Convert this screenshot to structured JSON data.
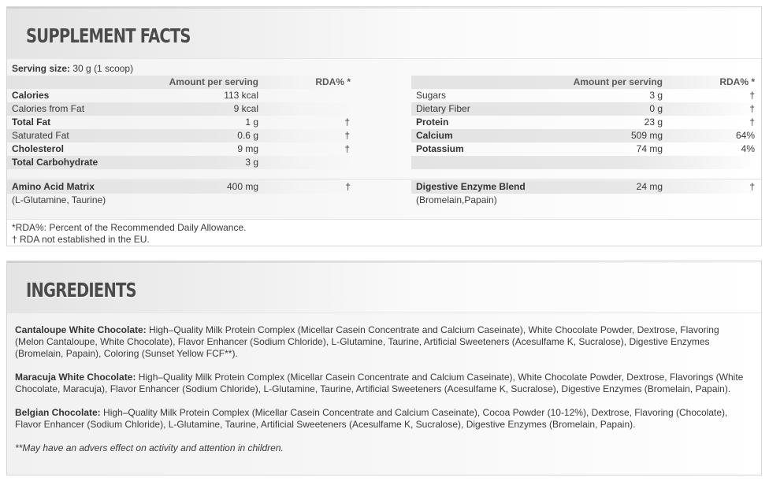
{
  "facts": {
    "title": "SUPPLEMENT FACTS",
    "serving_label": "Serving size:",
    "serving_value": "30 g (1 scoop)",
    "col_amount": "Amount per serving",
    "col_rda": "RDA% *",
    "left_rows": [
      {
        "name": "Calories",
        "amount": "113 kcal",
        "rda": ""
      },
      {
        "name": "Calories from Fat",
        "amount": "9 kcal",
        "rda": ""
      },
      {
        "name": "Total Fat",
        "amount": "1 g",
        "rda": "†"
      },
      {
        "name": "Saturated Fat",
        "amount": "0.6 g",
        "rda": "†"
      },
      {
        "name": "Cholesterol",
        "amount": "9 mg",
        "rda": "†"
      },
      {
        "name": "Total Carbohydrate",
        "amount": "3 g",
        "rda": ""
      }
    ],
    "right_rows": [
      {
        "name": "Sugars",
        "amount": "3 g",
        "rda": "†"
      },
      {
        "name": "Dietary Fiber",
        "amount": "0 g",
        "rda": "†"
      },
      {
        "name": "Protein",
        "amount": "23 g",
        "rda": "†"
      },
      {
        "name": "Calcium",
        "amount": "509 mg",
        "rda": "64%"
      },
      {
        "name": "Potassium",
        "amount": "74 mg",
        "rda": "4%"
      },
      {
        "name": "",
        "amount": "",
        "rda": ""
      }
    ],
    "blend_left": {
      "name": "Amino Acid Matrix",
      "amount": "400 mg",
      "rda": "†",
      "sub": "(L-Glutamine, Taurine)"
    },
    "blend_right": {
      "name": "Digestive Enzyme Blend",
      "amount": "24 mg",
      "rda": "†",
      "sub": "(Bromelain,Papain)"
    },
    "note1": "*RDA%: Percent of the Recommended Daily Allowance.",
    "note2": "† RDA not established in the EU."
  },
  "ingredients": {
    "title": "INGREDIENTS",
    "items": [
      {
        "flavor": "Cantaloupe White Chocolate:",
        "text": " High–Quality Milk Protein Complex (Micellar Casein Concentrate and Calcium Caseinate), White Chocolate Powder, Dextrose, Flavoring (Melon Cantaloupe, White Chocolate), Flavor Enhancer (Sodium Chloride), L-Glutamine, Taurine, Artificial Sweeteners (Acesulfame K, Sucralose), Digestive Enzymes (Bromelain, Papain), Coloring (Sunset Yellow FCF**)."
      },
      {
        "flavor": "Maracuja White Chocolate:",
        "text": " High–Quality Milk Protein Complex (Micellar Casein Concentrate and Calcium Caseinate), White Chocolate Powder, Dextrose, Flavorings (White Chocolate, Maracuja), Flavor Enhancer (Sodium Chloride), L-Glutamine, Taurine, Artificial Sweeteners (Acesulfame K, Sucralose), Digestive Enzymes (Bromelain, Papain)."
      },
      {
        "flavor": "Belgian Chocolate:",
        "text": " High–Quality Milk Protein Complex (Micellar Casein Concentrate and Calcium Caseinate), Cocoa Powder (10-12%), Dextrose, Flavoring (Chocolate), Flavor Enhancer (Sodium Chloride), L-Glutamine, Taurine, Artificial Sweeteners (Acesulfame K, Sucralose), Digestive Enzymes (Bromelain, Papain)."
      }
    ],
    "note": "**May have an advers effect on activity and attention in children."
  }
}
